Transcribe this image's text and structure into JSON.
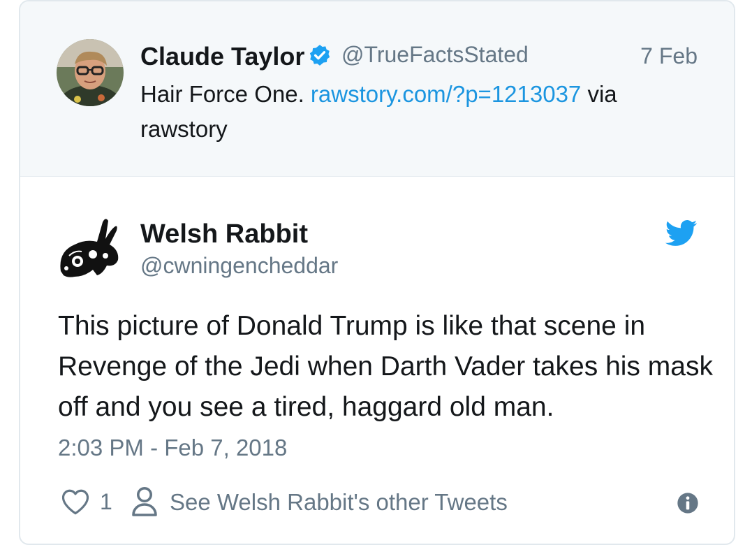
{
  "parent_tweet": {
    "name": "Claude Taylor",
    "handle": "@TrueFactsStated",
    "date": "7 Feb",
    "text_before": "Hair Force One. ",
    "link": "rawstory.com/?p=1213037",
    "text_after": " via rawstory",
    "verified_icon": "verified-badge-icon"
  },
  "tweet": {
    "name": "Welsh Rabbit",
    "handle": "@cwningencheddar",
    "text": "This picture of Donald Trump is like that scene in Revenge of the Jedi when Darth Vader takes his mask off and you see a tired, haggard old man.",
    "timestamp": "2:03 PM - Feb 7, 2018",
    "like_count": "1",
    "other_tweets_label": "See Welsh Rabbit's other Tweets"
  },
  "icons": {
    "brand": "twitter-bird-icon",
    "like": "heart-icon",
    "profile": "person-icon",
    "info": "info-icon"
  },
  "colors": {
    "link": "#1b95e0",
    "twitter_blue": "#1da1f2",
    "secondary_text": "#657786",
    "parent_bg": "#f5f8fa"
  }
}
